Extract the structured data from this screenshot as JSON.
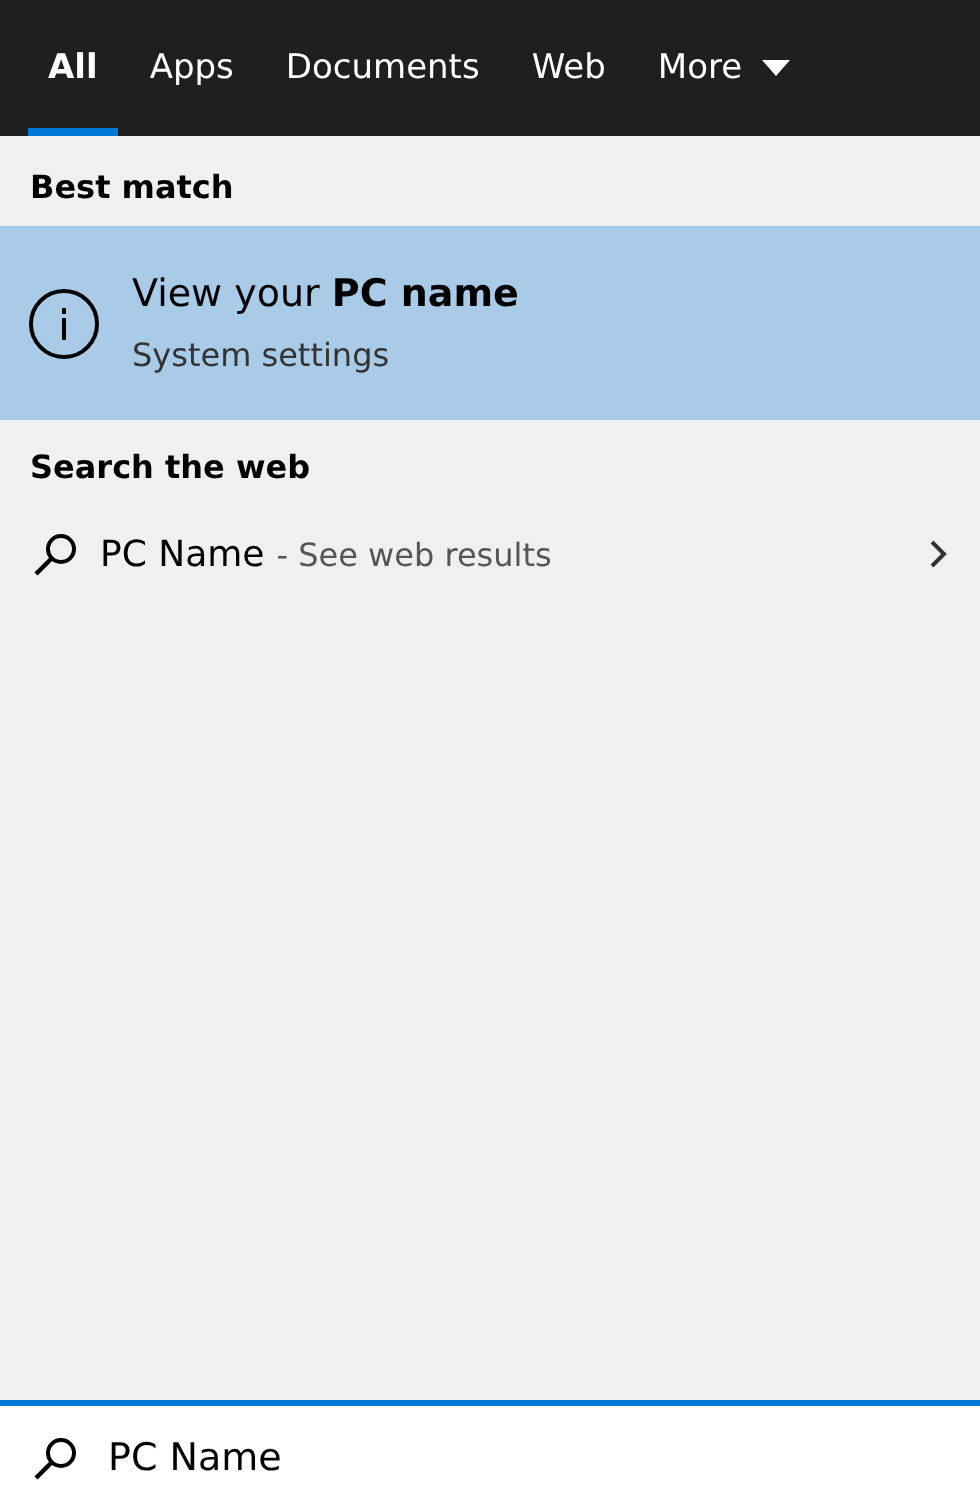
{
  "tabs": [
    {
      "label": "All",
      "selected": true,
      "kind": "plain"
    },
    {
      "label": "Apps",
      "selected": false,
      "kind": "plain"
    },
    {
      "label": "Documents",
      "selected": false,
      "kind": "plain"
    },
    {
      "label": "Web",
      "selected": false,
      "kind": "plain"
    },
    {
      "label": "More",
      "selected": false,
      "kind": "dropdown"
    }
  ],
  "best_match": {
    "heading": "Best match",
    "item": {
      "title": "View your **PC name**",
      "subtitle": "System settings",
      "selected": true
    }
  },
  "web": {
    "heading": "Search the web",
    "item": {
      "query": "PC Name",
      "hint": "- See web results"
    }
  },
  "search_box": {
    "value": "PC Name"
  }
}
